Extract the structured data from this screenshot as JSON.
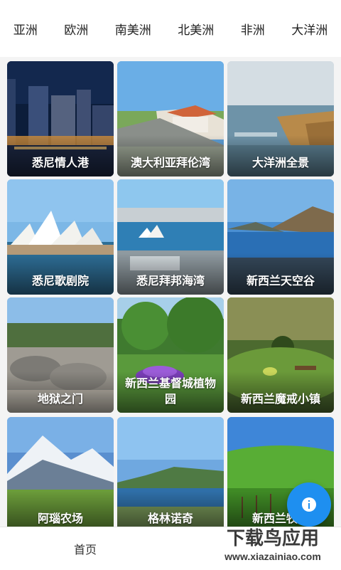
{
  "tabs": [
    "亚洲",
    "欧洲",
    "南美洲",
    "北美洲",
    "非洲",
    "大洋洲"
  ],
  "cards": [
    {
      "label": "悉尼情人港"
    },
    {
      "label": "澳大利亚拜伦湾"
    },
    {
      "label": "大洋洲全景"
    },
    {
      "label": "悉尼歌剧院"
    },
    {
      "label": "悉尼拜邦海湾"
    },
    {
      "label": "新西兰天空谷"
    },
    {
      "label": "地狱之门"
    },
    {
      "label": "新西兰基督城植物园"
    },
    {
      "label": "新西兰魔戒小镇"
    },
    {
      "label": "阿瑙农场"
    },
    {
      "label": "格林诺奇"
    },
    {
      "label": "新西兰牧场"
    }
  ],
  "bottom_nav": {
    "home": "首页"
  },
  "watermark": {
    "brand": "下载鸟应用",
    "url": "www.xiazainiao.com"
  },
  "colors": {
    "accent": "#1e8ff0"
  }
}
